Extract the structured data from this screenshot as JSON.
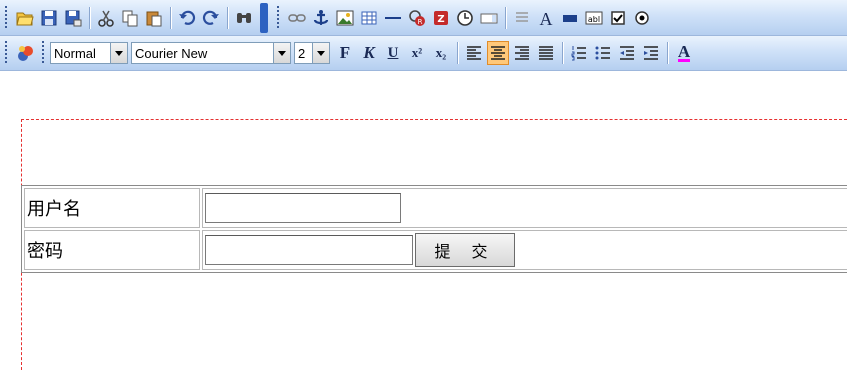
{
  "toolbar1": {
    "icons": [
      "folder-open",
      "save",
      "save-as",
      "cut",
      "copy",
      "paste",
      "undo",
      "redo",
      "find",
      "link",
      "anchor",
      "image",
      "table",
      "horizontal-rule",
      "special-char",
      "flash",
      "clock",
      "textarea",
      "list-box",
      "text",
      "button",
      "text-field",
      "checkbox",
      "radio"
    ]
  },
  "toolbar2": {
    "style_value": "Normal",
    "font_value": "Courier New",
    "size_value": "2",
    "bold_label": "F",
    "italic_label": "K",
    "underline_label": "U",
    "superscript_label": "x²",
    "subscript_label": "x₂",
    "font_color_label": "A"
  },
  "form": {
    "username_label": "用户名",
    "password_label": "密码",
    "submit_label": "提 交",
    "username_value": "",
    "password_value": ""
  }
}
